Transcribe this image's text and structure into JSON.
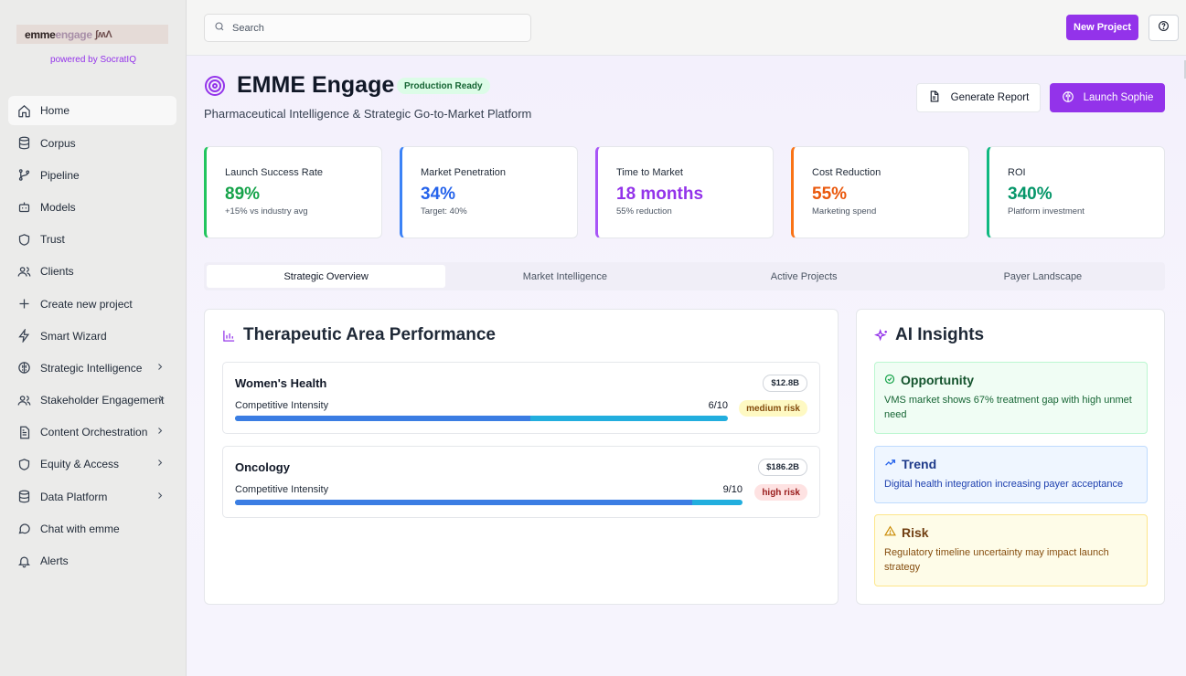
{
  "brand": {
    "logo_part1": "emme",
    "logo_part2": "engage",
    "logo_part3": "ʃʍɅ",
    "powered_by": "powered by SocratIQ"
  },
  "sidebar": {
    "items": [
      {
        "label": "Home",
        "icon": "home-icon"
      },
      {
        "label": "Corpus",
        "icon": "database-icon"
      },
      {
        "label": "Pipeline",
        "icon": "git-branch-icon"
      },
      {
        "label": "Models",
        "icon": "bot-icon"
      },
      {
        "label": "Trust",
        "icon": "shield-icon"
      },
      {
        "label": "Clients",
        "icon": "users-icon"
      },
      {
        "label": "Create new project",
        "icon": "plus-icon"
      },
      {
        "label": "Smart Wizard",
        "icon": "zap-icon"
      },
      {
        "label": "Strategic Intelligence",
        "icon": "brain-icon"
      },
      {
        "label": "Stakeholder Engagement",
        "icon": "users-icon"
      },
      {
        "label": "Content Orchestration",
        "icon": "file-icon"
      },
      {
        "label": "Equity & Access",
        "icon": "shield-icon"
      },
      {
        "label": "Data Platform",
        "icon": "database-icon"
      },
      {
        "label": "Chat with emme",
        "icon": "chat-icon"
      },
      {
        "label": "Alerts",
        "icon": "bell-icon"
      }
    ]
  },
  "topbar": {
    "search_placeholder": "Search",
    "new_project": "New Project"
  },
  "header": {
    "title": "EMME Engage",
    "badge": "Production Ready",
    "subtitle": "Pharmaceutical Intelligence & Strategic Go-to-Market Platform",
    "generate_report": "Generate Report",
    "launch_sophie": "Launch Sophie"
  },
  "stats": [
    {
      "label": "Launch Success Rate",
      "value": "89%",
      "sub": "+15% vs industry avg",
      "color": "#16a34a"
    },
    {
      "label": "Market Penetration",
      "value": "34%",
      "sub": "Target: 40%",
      "color": "#2563eb"
    },
    {
      "label": "Time to Market",
      "value": "18 months",
      "sub": "55% reduction",
      "color": "#9333ea"
    },
    {
      "label": "Cost Reduction",
      "value": "55%",
      "sub": "Marketing spend",
      "color": "#ea580c"
    },
    {
      "label": "ROI",
      "value": "340%",
      "sub": "Platform investment",
      "color": "#059669"
    }
  ],
  "tabs": [
    "Strategic Overview",
    "Market Intelligence",
    "Active Projects",
    "Payer Landscape"
  ],
  "performance": {
    "title": "Therapeutic Area Performance",
    "areas": [
      {
        "name": "Women's Health",
        "market": "$12.8B",
        "metric": "Competitive Intensity",
        "score": "6/10",
        "intensity": 0.6,
        "risk": "medium risk"
      },
      {
        "name": "Oncology",
        "market": "$186.2B",
        "metric": "Competitive Intensity",
        "score": "9/10",
        "intensity": 0.9,
        "risk": "high risk"
      }
    ]
  },
  "insights": {
    "title": "AI Insights",
    "opportunity": {
      "title": "Opportunity",
      "text": "VMS market shows 67% treatment gap with high unmet need"
    },
    "trend": {
      "title": "Trend",
      "text": "Digital health integration increasing payer acceptance"
    },
    "risk": {
      "title": "Risk",
      "text": "Regulatory timeline uncertainty may impact launch strategy"
    }
  }
}
